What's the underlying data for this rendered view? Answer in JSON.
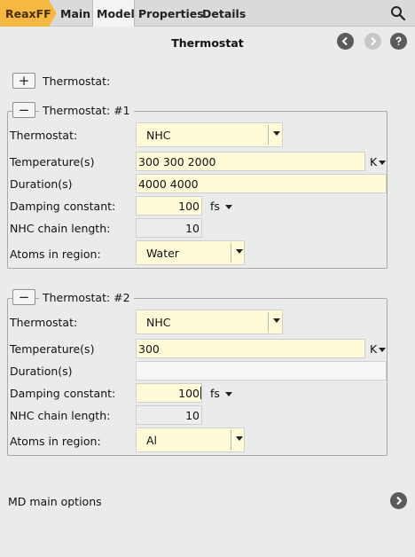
{
  "tabs": {
    "reaxff": "ReaxFF",
    "main": "Main",
    "model": "Model",
    "properties": "Properties",
    "details": "Details"
  },
  "page": {
    "title": "Thermostat"
  },
  "add_row": {
    "label": "Thermostat:"
  },
  "thermostats": [
    {
      "legend": "Thermostat: #1",
      "thermostat_label": "Thermostat:",
      "thermostat_value": "NHC",
      "temperature_label": "Temperature(s)",
      "temperature_value": "300 300 2000",
      "temperature_unit": "K",
      "duration_label": "Duration(s)",
      "duration_value": "4000 4000",
      "damping_label": "Damping constant:",
      "damping_value": "100",
      "damping_unit": "fs",
      "chain_label": "NHC chain length:",
      "chain_value": "10",
      "atoms_label": "Atoms in region:",
      "atoms_value": "Water"
    },
    {
      "legend": "Thermostat: #2",
      "thermostat_label": "Thermostat:",
      "thermostat_value": "NHC",
      "temperature_label": "Temperature(s)",
      "temperature_value": "300",
      "temperature_unit": "K",
      "duration_label": "Duration(s)",
      "duration_value": "",
      "damping_label": "Damping constant:",
      "damping_value": "100",
      "damping_unit": "fs",
      "chain_label": "NHC chain length:",
      "chain_value": "10",
      "atoms_label": "Atoms in region:",
      "atoms_value": "Al"
    }
  ],
  "footer": {
    "md_options_label": "MD main options"
  },
  "colors": {
    "brand_tab": "#f5b942",
    "field_bg": "#fffbd8"
  },
  "icons": [
    "search-icon",
    "back-icon",
    "forward-icon",
    "help-icon",
    "plus-icon",
    "minus-icon",
    "chevron-right-icon"
  ]
}
